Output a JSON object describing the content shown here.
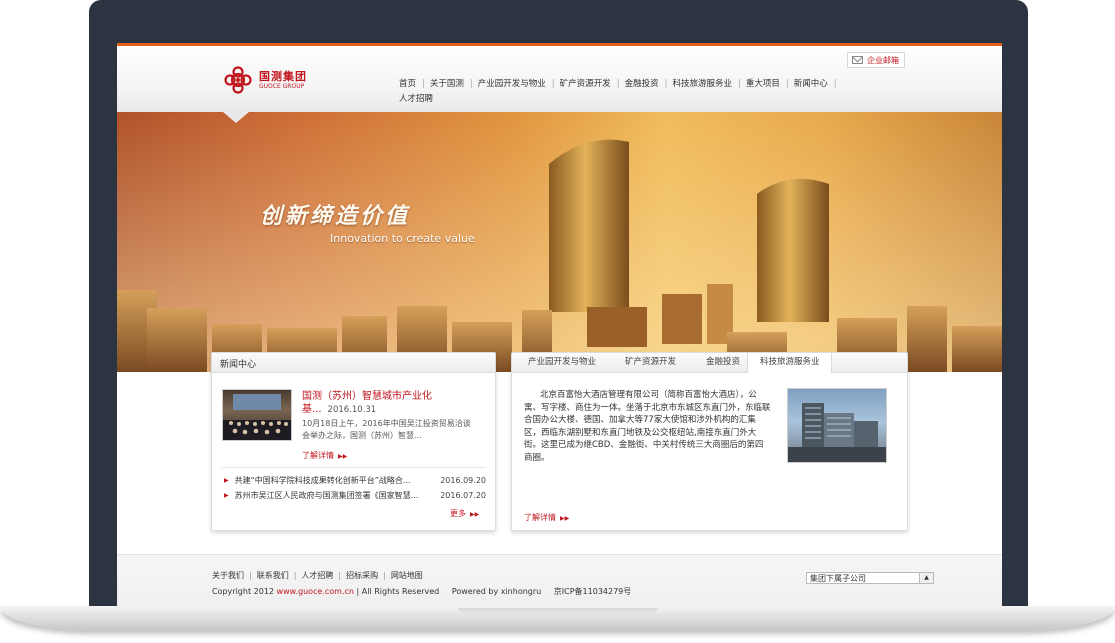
{
  "colors": {
    "accent": "#c0161e",
    "top_bar": "#e4601a",
    "frame": "#2b3440"
  },
  "header": {
    "logo_cn": "国测集团",
    "logo_en": "GUOCE GROUP",
    "mail_label": "企业邮箱",
    "nav": [
      "首页",
      "关于国测",
      "产业园开发与物业",
      "矿产资源开发",
      "金融投资",
      "科技旅游服务业",
      "重大项目",
      "新闻中心",
      "人才招聘"
    ]
  },
  "banner": {
    "slogan_cn": "创新缔造价值",
    "slogan_en": "Innovation to create value"
  },
  "news": {
    "title": "新闻中心",
    "featured": {
      "title": "国测（苏州）智慧城市产业化基...",
      "date": "2016.10.31",
      "desc": "10月18日上午，2016年中国吴江投资贸易洽谈会举办之际，国测（苏州）智慧...",
      "more": "了解详情"
    },
    "list": [
      {
        "title": "共建“中国科学院科技成果转化创新平台”战略合...",
        "date": "2016.09.20"
      },
      {
        "title": "苏州市吴江区人民政府与国测集团签署《国家智慧...",
        "date": "2016.07.20"
      }
    ],
    "more": "更多"
  },
  "business": {
    "tabs": [
      "产业园开发与物业",
      "矿产资源开发",
      "金融投资",
      "科技旅游服务业"
    ],
    "active_tab": "科技旅游服务业",
    "text": "北京百富怡大酒店管理有限公司（简称百富怡大酒店），公寓、写字楼、商住为一体。坐落于北京市东城区东直门外，东临联合国办公大楼、德国、加拿大等77家大使馆和涉外机构的汇集区，西临东湖别墅和东直门地铁及公交枢纽站,南接东直门外大街。这里已成为继CBD、金融街、中关村传统三大商圈后的第四商圈。",
    "more": "了解详情"
  },
  "footer": {
    "links": [
      "关于我们",
      "联系我们",
      "人才招聘",
      "招标采购",
      "网站地图"
    ],
    "copyright_prefix": "Copyright 2012",
    "url": "www.guoce.com.cn",
    "rights": "| All Rights Reserved",
    "powered": "Powered by xinhongru",
    "icp": "京ICP备11034279号",
    "select_value": "集团下属子公司"
  }
}
